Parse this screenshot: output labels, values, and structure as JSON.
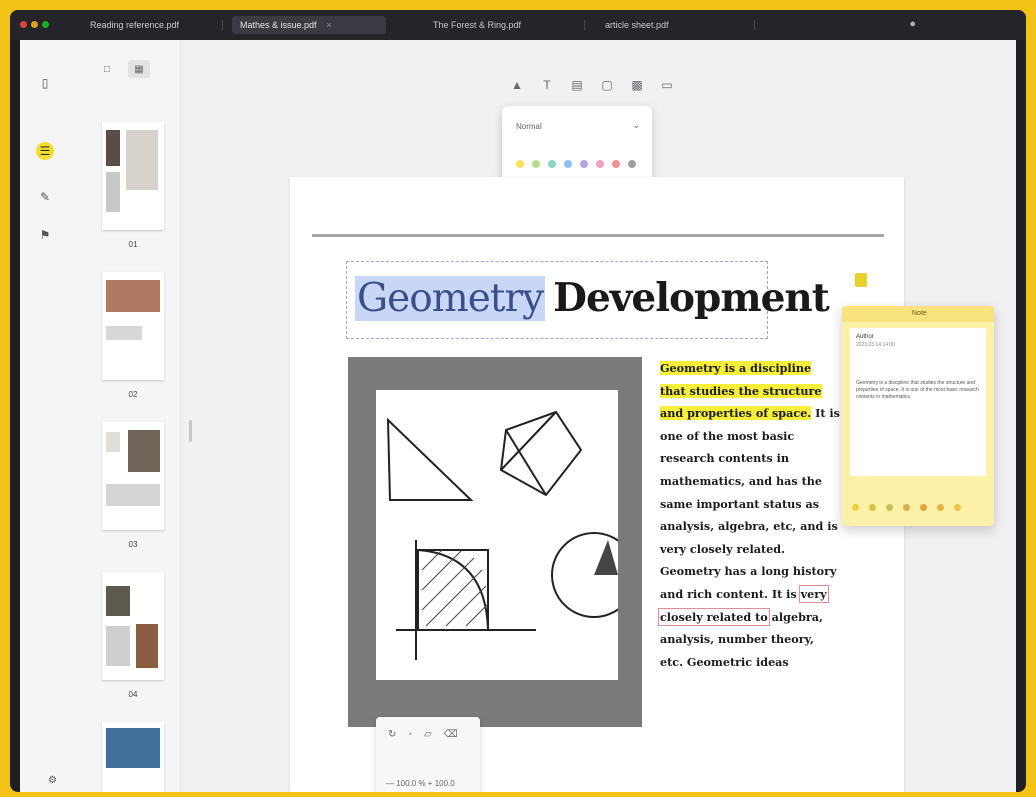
{
  "tabs": [
    {
      "label": "Reading reference.pdf",
      "active": false
    },
    {
      "label": "Mathes & issue.pdf",
      "active": true
    },
    {
      "label": "The Forest & Ring.pdf",
      "active": false
    },
    {
      "label": "article sheet.pdf",
      "active": false
    }
  ],
  "toolbar": {
    "left_rail": [
      "outline-icon",
      "annotation-icon",
      "bookmark-icon"
    ],
    "thumb_tools": [
      "single-page-icon",
      "grid-view-icon"
    ],
    "main_tools": [
      "highlight-icon",
      "text-icon",
      "text-box-icon",
      "shape-icon",
      "image-icon",
      "stamp-icon"
    ]
  },
  "color_popup": {
    "label": "Normal",
    "swatches": [
      "#f7e25a",
      "#b7dd8a",
      "#8fd3c6",
      "#8cc3f2",
      "#b9a2ea",
      "#f0a2c4",
      "#f58f8f",
      "#a0a0a0"
    ]
  },
  "thumbnails": {
    "page_numbers": [
      "01",
      "02",
      "03",
      "04"
    ]
  },
  "document": {
    "title_word_1": "Geometry",
    "title_word_2": "Development",
    "paragraph": {
      "highlighted": "Geometry is a discipline that studies the structure and properties of space.",
      "middle": " It is one of the most basic research contents in mathematics, and has the same important status as analysis, algebra, etc, and is very closely related. Geometry has a long history and rich content. It is ",
      "boxed": "very closely related to",
      "end": " algebra, analysis, number theory, etc. Geometric ideas"
    }
  },
  "image_toolbar": {
    "zoom_label": "— 100.0 % + 100.0"
  },
  "sticky_note": {
    "header": "Note",
    "author": "Author",
    "date": "2023.03.14 14:00",
    "body": "Geometry is a discipline that studies the structure and properties of space. It is one of the most basic research contents in mathematics.",
    "swatches": [
      "#f2cf35",
      "#d9c346",
      "#c7c05a",
      "#d6b04d",
      "#e0a33e",
      "#e8b240",
      "#f0c548"
    ]
  }
}
